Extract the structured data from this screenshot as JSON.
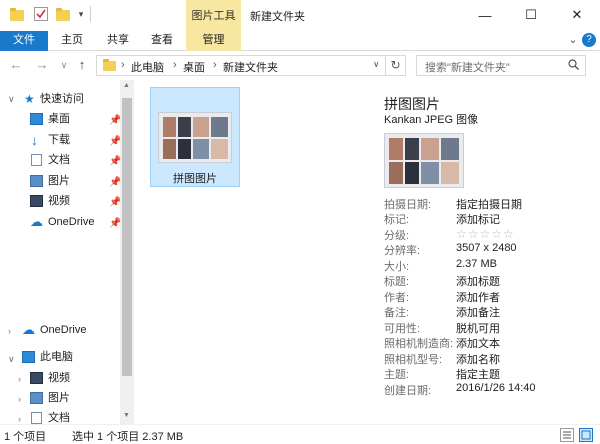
{
  "window": {
    "title": "新建文件夹",
    "contextual_tab_header": "图片工具",
    "minimize_symbol": "—",
    "maximize_symbol": "☐",
    "close_symbol": "✕"
  },
  "ribbon": {
    "tabs": [
      {
        "label": "文件",
        "active": true
      },
      {
        "label": "主页"
      },
      {
        "label": "共享"
      },
      {
        "label": "查看"
      },
      {
        "label": "管理",
        "contextual": true
      }
    ],
    "expand_symbol": "⌄",
    "help_symbol": "?"
  },
  "address_bar": {
    "breadcrumbs": [
      "此电脑",
      "桌面",
      "新建文件夹"
    ],
    "separator": "›",
    "dropdown_symbol": "∨",
    "refresh_symbol": "↻"
  },
  "search": {
    "placeholder": "搜索\"新建文件夹\""
  },
  "nav_pane": {
    "quick_access": {
      "label": "快速访问",
      "items": [
        {
          "label": "桌面",
          "icon": "desktop-icon"
        },
        {
          "label": "下载",
          "icon": "download-icon"
        },
        {
          "label": "文档",
          "icon": "document-icon"
        },
        {
          "label": "图片",
          "icon": "pictures-icon"
        },
        {
          "label": "视频",
          "icon": "video-icon"
        },
        {
          "label": "OneDrive",
          "icon": "onedrive-icon"
        }
      ]
    },
    "onedrive_label": "OneDrive",
    "this_pc": {
      "label": "此电脑",
      "items": [
        {
          "label": "视频",
          "icon": "video-icon"
        },
        {
          "label": "图片",
          "icon": "pictures-icon"
        },
        {
          "label": "文档",
          "icon": "document-icon"
        }
      ]
    }
  },
  "files": [
    {
      "name": "拼图图片",
      "selected": true
    }
  ],
  "details": {
    "title": "拼图图片",
    "type": "Kankan JPEG 图像",
    "properties": [
      {
        "key": "拍摄日期:",
        "value": "指定拍摄日期"
      },
      {
        "key": "标记:",
        "value": "添加标记"
      },
      {
        "key": "分级:",
        "value": "",
        "rating": 0,
        "rating_max": 5
      },
      {
        "key": "分辨率:",
        "value": "3507 x 2480"
      },
      {
        "key": "大小:",
        "value": "2.37 MB"
      },
      {
        "key": "标题:",
        "value": "添加标题"
      },
      {
        "key": "作者:",
        "value": "添加作者"
      },
      {
        "key": "备注:",
        "value": "添加备注"
      },
      {
        "key": "可用性:",
        "value": "脱机可用"
      },
      {
        "key": "照相机制造商:",
        "value": "添加文本"
      },
      {
        "key": "照相机型号:",
        "value": "添加名称"
      },
      {
        "key": "主题:",
        "value": "指定主题"
      },
      {
        "key": "创建日期:",
        "value": "2016/1/26 14:40"
      }
    ],
    "rating_symbols": "☆☆☆☆☆"
  },
  "status_bar": {
    "item_count": "1 个项目",
    "selection": "选中 1 个项目  2.37 MB"
  },
  "colors": {
    "accent": "#1979ca",
    "contextual": "#f8e7a0",
    "selection": "#cce8ff",
    "folder": "#f3cf55"
  }
}
